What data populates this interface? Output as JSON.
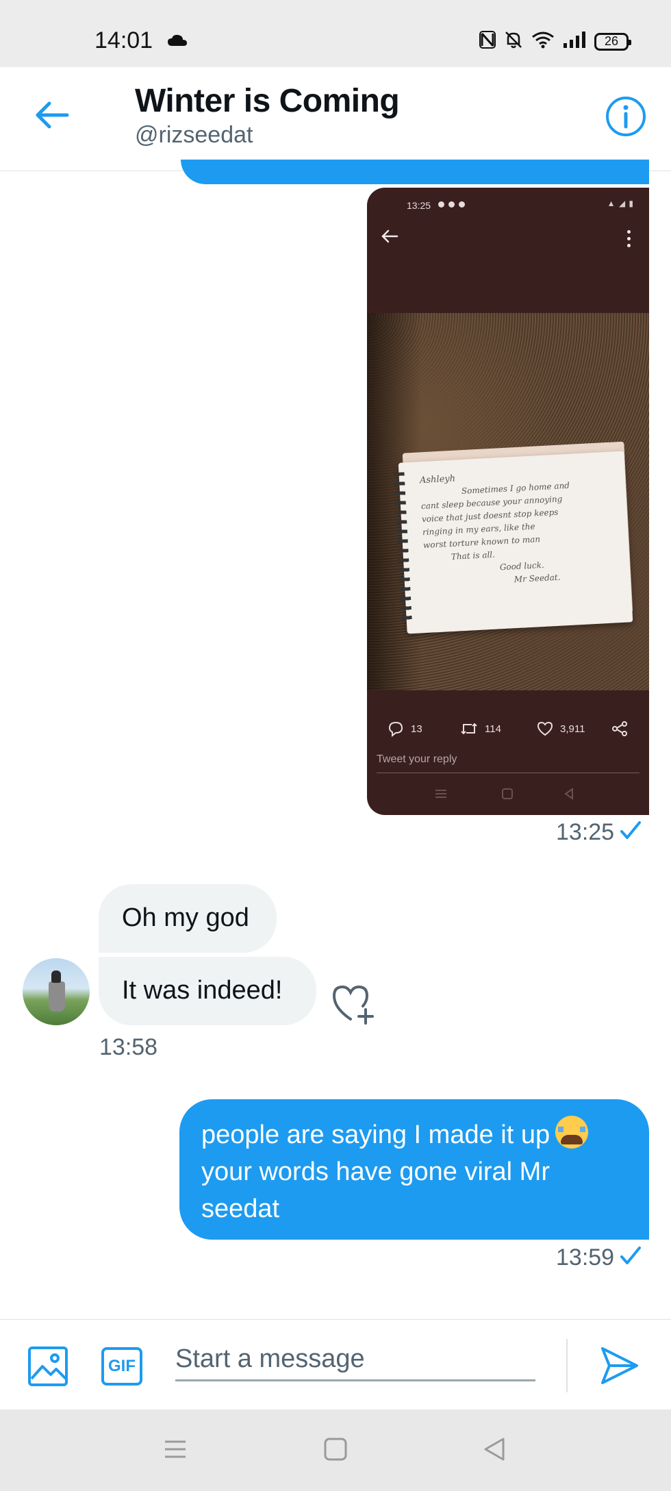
{
  "status_bar": {
    "time": "14:01",
    "battery": "26",
    "icons": [
      "cloud-icon",
      "nfc-icon",
      "mute-icon",
      "wifi-icon",
      "signal-icon",
      "battery-icon"
    ]
  },
  "header": {
    "title": "Winter is Coming",
    "handle": "@rizseedat",
    "back_icon": "back-arrow-icon",
    "info_icon": "info-icon"
  },
  "messages": [
    {
      "type": "image",
      "direction": "outgoing",
      "time": "13:25",
      "screenshot": {
        "time": "13:25",
        "note_lines": [
          "Ashleyh",
          "Sometimes I go home and",
          "cant sleep because your annoying",
          "voice that just doesnt stop keeps",
          "ringing in my ears, like the",
          "worst torture known to man",
          "That is all.",
          "Good luck.",
          "Mr Seedat."
        ],
        "replies": "13",
        "retweets": "114",
        "likes": "3,911",
        "reply_placeholder": "Tweet your reply"
      }
    },
    {
      "type": "text",
      "direction": "incoming",
      "text": "Oh my god"
    },
    {
      "type": "text",
      "direction": "incoming",
      "text": "It was indeed!",
      "time": "13:58"
    },
    {
      "type": "text",
      "direction": "outgoing",
      "text": "people are saying I made it up",
      "text_line2": "your words have gone viral Mr",
      "text_line3": "seedat",
      "emoji": "loudly-crying-face",
      "time": "13:59"
    }
  ],
  "composer": {
    "placeholder": "Start a message",
    "gif_label": "GIF"
  },
  "colors": {
    "accent": "#1d9bf0",
    "incoming_bubble": "#eff3f4",
    "secondary_text": "#536471"
  }
}
